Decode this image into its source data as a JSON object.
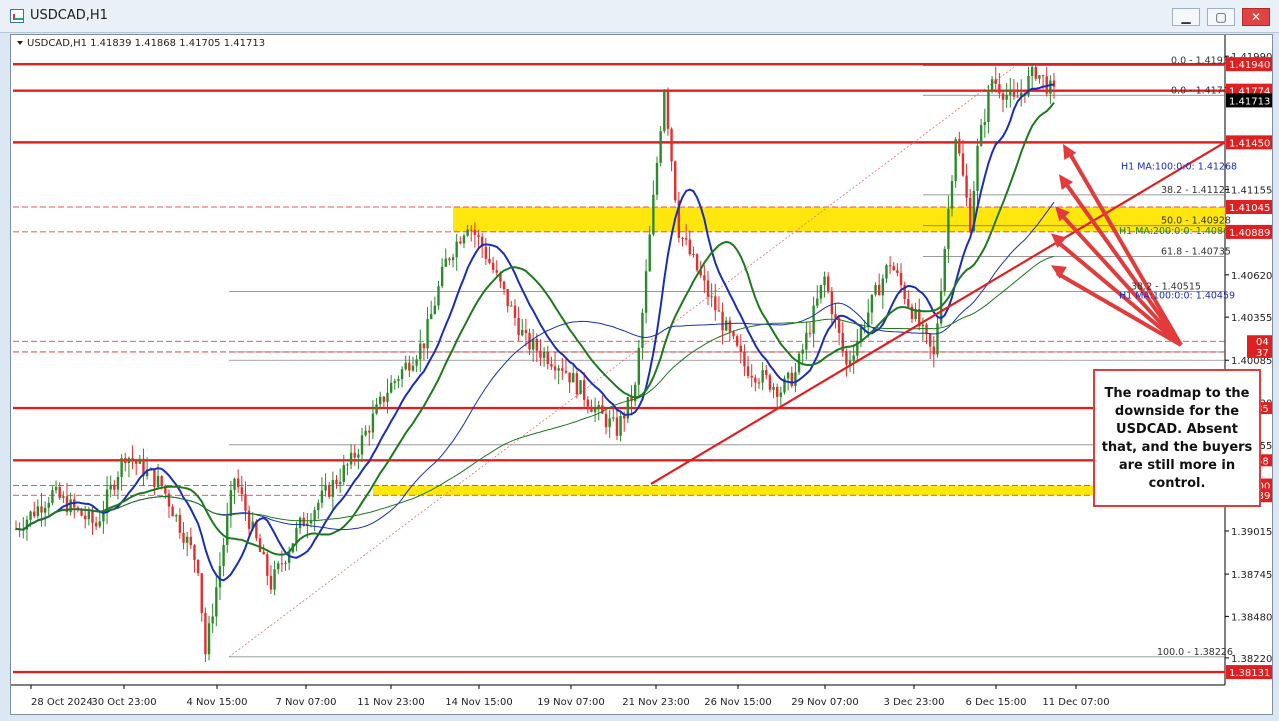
{
  "window": {
    "title": "USDCAD,H1",
    "buttons": {
      "minimize": "▁",
      "maximize": "▢",
      "close": "✕"
    }
  },
  "annotation": {
    "text": "The roadmap to the downside for the USDCAD. Absent that, and the buyers are still more in control."
  },
  "chart_data": {
    "type": "candlestick",
    "symbol_header": "USDCAD,H1  1.41839 1.41868 1.41705 1.41713",
    "y_axis_ticks": [
      "1.41990",
      "1.41155",
      "1.40620",
      "1.40355",
      "1.40085",
      "1.39820",
      "1.39555",
      "1.39290",
      "1.39015",
      "1.38745",
      "1.38480",
      "1.38220"
    ],
    "y_axis_ticks_values": [
      1.4199,
      1.41155,
      1.4062,
      1.40355,
      1.40085,
      1.3982,
      1.39555,
      1.3929,
      1.39015,
      1.38745,
      1.3848,
      1.3822
    ],
    "x_axis_ticks": [
      "28 Oct 2024",
      "30 Oct 23:00",
      "4 Nov 15:00",
      "7 Nov 07:00",
      "11 Nov 23:00",
      "14 Nov 15:00",
      "19 Nov 07:00",
      "21 Nov 23:00",
      "26 Nov 15:00",
      "29 Nov 07:00",
      "3 Dec 23:00",
      "6 Dec 15:00",
      "11 Dec 07:00"
    ],
    "price_lines": [
      {
        "label": "1.41940",
        "value": 1.4194,
        "color": "#e02020"
      },
      {
        "label": "1.41774",
        "value": 1.41774,
        "color": "#e02020"
      },
      {
        "label": "1.41713",
        "value": 1.41713,
        "color": "#000000"
      },
      {
        "label": "1.41450",
        "value": 1.4145,
        "color": "#e02020"
      },
      {
        "label": "1.41045",
        "value": 1.41045,
        "color": "#e02020"
      },
      {
        "label": "1.40889",
        "value": 1.40889,
        "color": "#e02020"
      },
      {
        "label": "1.39300",
        "value": 1.393,
        "color": "#e02020"
      },
      {
        "label": "1.39239",
        "value": 1.39239,
        "color": "#e02020"
      },
      {
        "label": "1.38131",
        "value": 1.38131,
        "color": "#e02020"
      }
    ],
    "partial_tags": [
      {
        "label": "04",
        "value": 1.40204
      },
      {
        "label": "37",
        "value": 1.40137
      },
      {
        "label": "85",
        "value": 1.39785
      },
      {
        "label": "58",
        "value": 1.39458
      }
    ],
    "fib_labels": [
      {
        "label": "0.0 - 1.41931",
        "value": 1.41931
      },
      {
        "label": "0.0 - 1.41745",
        "value": 1.41745
      },
      {
        "label": "38.2 - 1.41121",
        "value": 1.41121
      },
      {
        "label": "50.0 - 1.40928",
        "value": 1.40928
      },
      {
        "label": "61.8 - 1.40735",
        "value": 1.40735
      },
      {
        "label": "38.2 - 1.40515",
        "value": 1.40515
      },
      {
        "label": "100.0 - 1.38226",
        "value": 1.38226
      }
    ],
    "ma_labels": [
      {
        "label": "H1 MA:100:0:0: 1.41268",
        "value": 1.41268,
        "color": "#1a2fb8"
      },
      {
        "label": "H1 MA:200:0:0: 1.40864",
        "value": 1.40864,
        "color": "#1f7a1f"
      },
      {
        "label": "H1 MA:100:0:0: 1.40459",
        "value": 1.40459,
        "color": "#1a2fb8"
      }
    ],
    "highlight_zones": [
      {
        "from": 1.40889,
        "to": 1.41045,
        "color": "#ffe600"
      },
      {
        "from": 1.39239,
        "to": 1.393,
        "color": "#ffe600"
      }
    ],
    "ylim": [
      1.3805,
      1.42035
    ],
    "colors": {
      "up": "#2c8a2c",
      "down": "#e03030",
      "ma100": "#1a2fb8",
      "ma200": "#1f7a1f",
      "level": "#e02020"
    }
  }
}
